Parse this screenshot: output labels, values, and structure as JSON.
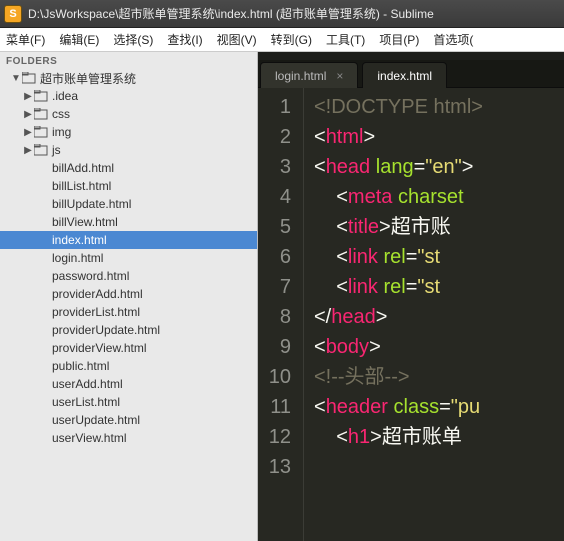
{
  "window": {
    "title": "D:\\JsWorkspace\\超市账单管理系统\\index.html (超市账单管理系统) - Sublime",
    "icon_letter": "S"
  },
  "menu": [
    "菜单(F)",
    "编辑(E)",
    "选择(S)",
    "查找(I)",
    "视图(V)",
    "转到(G)",
    "工具(T)",
    "项目(P)",
    "首选项("
  ],
  "sidebar": {
    "header": "FOLDERS",
    "root": "超市账单管理系统",
    "folders": [
      ".idea",
      "css",
      "img",
      "js"
    ],
    "files": [
      "billAdd.html",
      "billList.html",
      "billUpdate.html",
      "billView.html",
      "index.html",
      "login.html",
      "password.html",
      "providerAdd.html",
      "providerList.html",
      "providerUpdate.html",
      "providerView.html",
      "public.html",
      "userAdd.html",
      "userList.html",
      "userUpdate.html",
      "userView.html"
    ],
    "selected_file": "index.html"
  },
  "tabs": {
    "items": [
      {
        "label": "login.html",
        "active": false,
        "closable": true
      },
      {
        "label": "index.html",
        "active": true,
        "closable": false
      }
    ]
  },
  "code": {
    "line_count": 13,
    "lines": {
      "l1_doctype": "<!DOCTYPE html>",
      "l2_tag": "html",
      "l3_tag": "head",
      "l3_attr": "lang",
      "l3_val": "\"en\"",
      "l4_tag": "meta",
      "l4_attr": "charset",
      "l5_tag": "title",
      "l5_text": "超市账",
      "l6_tag": "link",
      "l6_attr": "rel",
      "l6_val": "\"st",
      "l7_tag": "link",
      "l7_attr": "rel",
      "l7_val": "\"st",
      "l8_close": "head",
      "l9_tag": "body",
      "l10_cmt": "<!--头部-->",
      "l11_tag": "header",
      "l11_attr": "class",
      "l11_val": "\"pu",
      "l12_tag": "h1",
      "l12_text": "超市账单"
    }
  }
}
